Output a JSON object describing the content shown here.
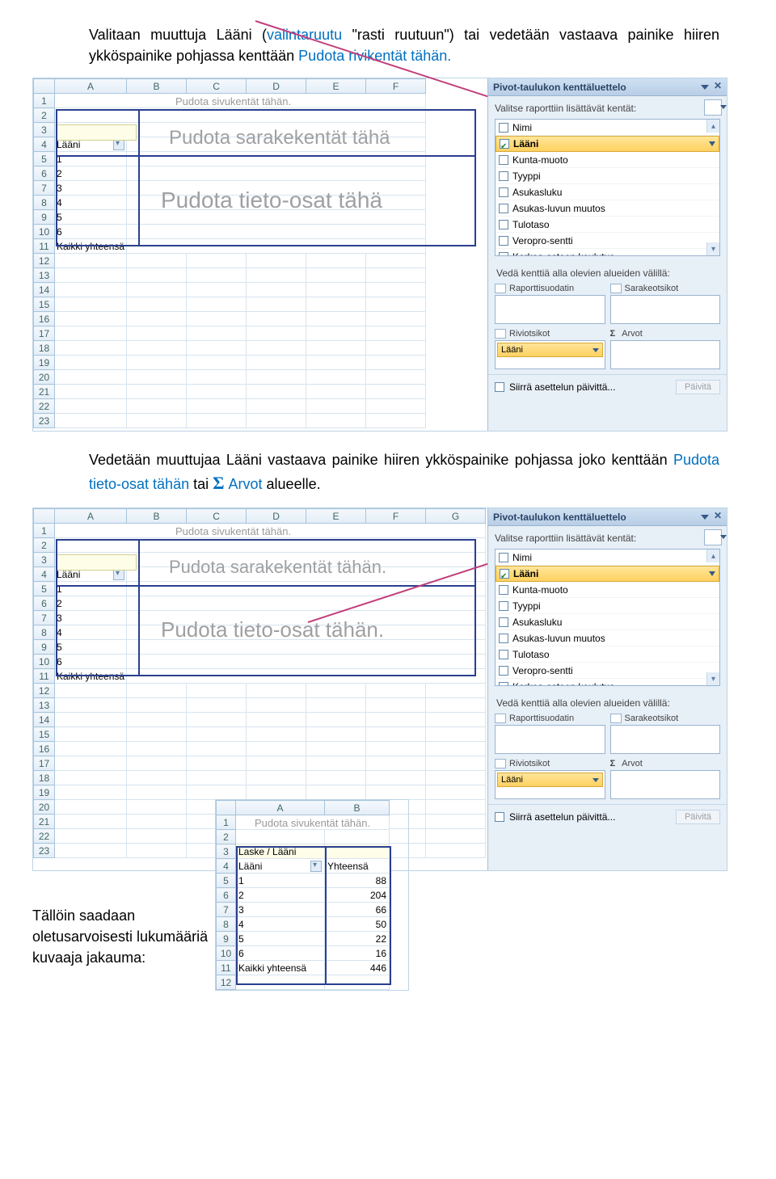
{
  "para1": {
    "a": "Valitaan muuttuja Lääni (",
    "b": "valintaruutu",
    "c": " \"rasti ruutuun\") tai vedetään vastaava painike hiiren ykköspainike pohjassa kenttään ",
    "d": "Pudota rivikentät tähän",
    "e": "."
  },
  "para2": {
    "a": "Vedetään muuttujaa Lääni vastaava painike hiiren ykköspainike pohjassa joko kenttään ",
    "b": "Pudota tieto-osat tähän",
    "c": " tai ",
    "d": "Σ",
    "e": "Arvot",
    "f": " alueelle."
  },
  "para3": "Tällöin saadaan oletusarvoisesti lukumääriä kuvaaja jakauma:",
  "cols": [
    "A",
    "B",
    "C",
    "D",
    "E",
    "F",
    "G"
  ],
  "rows1": [
    "1",
    "2",
    "3",
    "4",
    "5",
    "6",
    "7",
    "8",
    "9",
    "10",
    "11",
    "12",
    "13",
    "14",
    "15",
    "16",
    "17",
    "18",
    "19",
    "20",
    "21",
    "22",
    "23"
  ],
  "rows2": [
    "1",
    "2",
    "3",
    "4",
    "5",
    "6",
    "7",
    "8",
    "9",
    "10",
    "11",
    "12",
    "13",
    "14",
    "15",
    "16",
    "17",
    "18",
    "19",
    "20",
    "21",
    "22",
    "23"
  ],
  "rowlabels": [
    "Lääni",
    "1",
    "2",
    "3",
    "4",
    "5",
    "6",
    "Kaikki yhteensä"
  ],
  "overlay": {
    "page": "Pudota sivukentät tähän.",
    "col1": "Pudota sarakekentät tähä",
    "col2": "Pudota sarakekentät tähän.",
    "data1": "Pudota tieto-osat tähä",
    "data2": "Pudota tieto-osat tähän."
  },
  "pane": {
    "title": "Pivot-taulukon kenttäluettelo",
    "sub": "Valitse raporttiin lisättävät kentät:",
    "fields": [
      {
        "label": "Nimi",
        "checked": false
      },
      {
        "label": "Lääni",
        "checked": true,
        "selected": true
      },
      {
        "label": "Kunta-muoto",
        "checked": false
      },
      {
        "label": "Tyyppi",
        "checked": false
      },
      {
        "label": "Asukasluku",
        "checked": false
      },
      {
        "label": "Asukas-luvun muutos",
        "checked": false
      },
      {
        "label": "Tulotaso",
        "checked": false
      },
      {
        "label": "Veropro-sentti",
        "checked": false
      },
      {
        "label": "Korkea-asteen koulutus",
        "checked": false
      }
    ],
    "areasLabel": "Vedä kenttiä alla olevien alueiden välillä:",
    "areaTitles": {
      "filter": "Raporttisuodatin",
      "cols": "Sarakeotsikot",
      "rows": "Riviotsikot",
      "vals": "Arvot"
    },
    "rowItem": "Lääni",
    "defer": "Siirrä asettelun päivittä...",
    "update": "Päivitä"
  },
  "shot3": {
    "cols": [
      "A",
      "B"
    ],
    "rows": [
      "1",
      "2",
      "3",
      "4",
      "5",
      "6",
      "7",
      "8",
      "9",
      "10",
      "11",
      "12"
    ],
    "page": "Pudota sivukentät tähän.",
    "r3a": "Laske / Lääni",
    "r4a": "Lääni",
    "r4b": "Yhteensä",
    "data": [
      {
        "a": "1",
        "b": "88"
      },
      {
        "a": "2",
        "b": "204"
      },
      {
        "a": "3",
        "b": "66"
      },
      {
        "a": "4",
        "b": "50"
      },
      {
        "a": "5",
        "b": "22"
      },
      {
        "a": "6",
        "b": "16"
      }
    ],
    "totA": "Kaikki yhteensä",
    "totB": "446"
  }
}
